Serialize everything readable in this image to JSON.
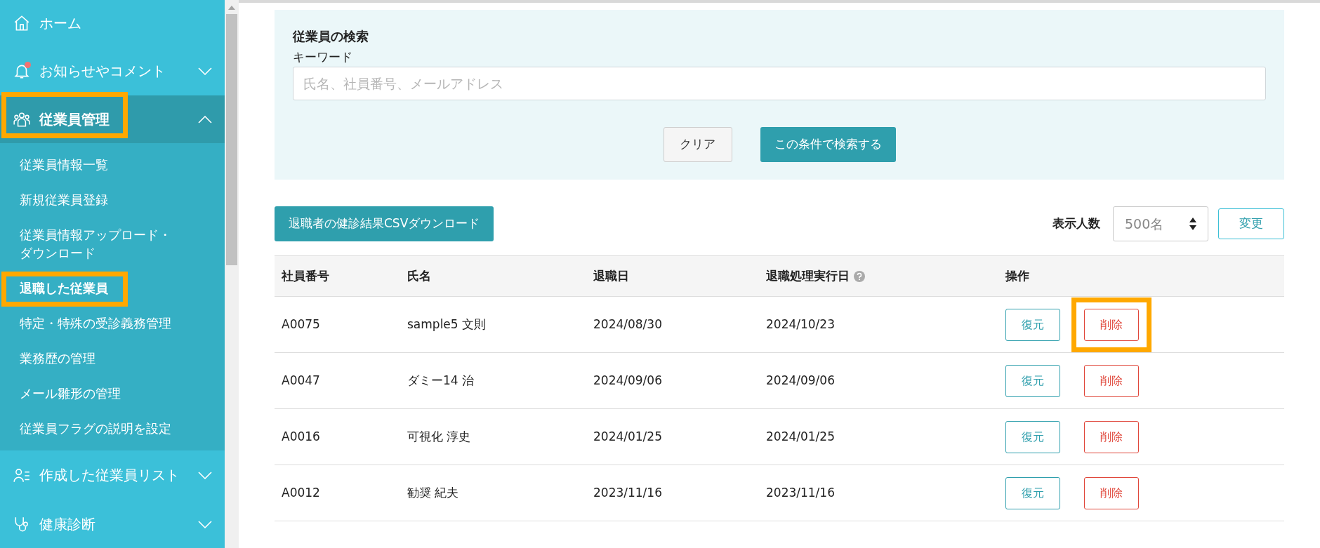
{
  "sidebar": {
    "items": [
      {
        "label": "ホーム",
        "expanded": false,
        "has_caret": false,
        "notification": false,
        "highlighted": false
      },
      {
        "label": "お知らせやコメント",
        "expanded": false,
        "has_caret": true,
        "notification": true,
        "highlighted": false
      },
      {
        "label": "従業員管理",
        "expanded": true,
        "has_caret": true,
        "notification": false,
        "highlighted": true,
        "children": [
          {
            "label": "従業員情報一覧",
            "selected": false,
            "highlighted": false
          },
          {
            "label": "新規従業員登録",
            "selected": false,
            "highlighted": false
          },
          {
            "label": "従業員情報アップロード・ダウンロード",
            "selected": false,
            "highlighted": false
          },
          {
            "label": "退職した従業員",
            "selected": true,
            "highlighted": true
          },
          {
            "label": "特定・特殊の受診義務管理",
            "selected": false,
            "highlighted": false
          },
          {
            "label": "業務歴の管理",
            "selected": false,
            "highlighted": false
          },
          {
            "label": "メール雛形の管理",
            "selected": false,
            "highlighted": false
          },
          {
            "label": "従業員フラグの説明を設定",
            "selected": false,
            "highlighted": false
          }
        ]
      },
      {
        "label": "作成した従業員リスト",
        "expanded": false,
        "has_caret": true,
        "notification": false,
        "highlighted": false
      },
      {
        "label": "健康診断",
        "expanded": false,
        "has_caret": true,
        "notification": false,
        "highlighted": false
      }
    ]
  },
  "search": {
    "title": "従業員の検索",
    "keyword_label": "キーワード",
    "placeholder": "氏名、社員番号、メールアドレス",
    "clear_button": "クリア",
    "search_button": "この条件で検索する"
  },
  "toolbar": {
    "download_button": "退職者の健診結果CSVダウンロード",
    "per_page_label": "表示人数",
    "per_page_value": "500名",
    "change_button": "変更"
  },
  "table": {
    "columns": [
      {
        "label": "社員番号",
        "help": false
      },
      {
        "label": "氏名",
        "help": false
      },
      {
        "label": "退職日",
        "help": false
      },
      {
        "label": "退職処理実行日",
        "help": true
      },
      {
        "label": "操作",
        "help": false
      }
    ],
    "rows": [
      {
        "id": "A0075",
        "name": "sample5 文則",
        "retired": "2024/08/30",
        "processed": "2024/10/23",
        "restore": "復元",
        "delete": "削除",
        "delete_highlighted": true
      },
      {
        "id": "A0047",
        "name": "ダミー14 治",
        "retired": "2024/09/06",
        "processed": "2024/09/06",
        "restore": "復元",
        "delete": "削除",
        "delete_highlighted": false
      },
      {
        "id": "A0016",
        "name": "可視化 淳史",
        "retired": "2024/01/25",
        "processed": "2024/01/25",
        "restore": "復元",
        "delete": "削除",
        "delete_highlighted": false
      },
      {
        "id": "A0012",
        "name": "勧奨 紀夫",
        "retired": "2023/11/16",
        "processed": "2023/11/16",
        "restore": "復元",
        "delete": "削除",
        "delete_highlighted": false
      }
    ]
  }
}
